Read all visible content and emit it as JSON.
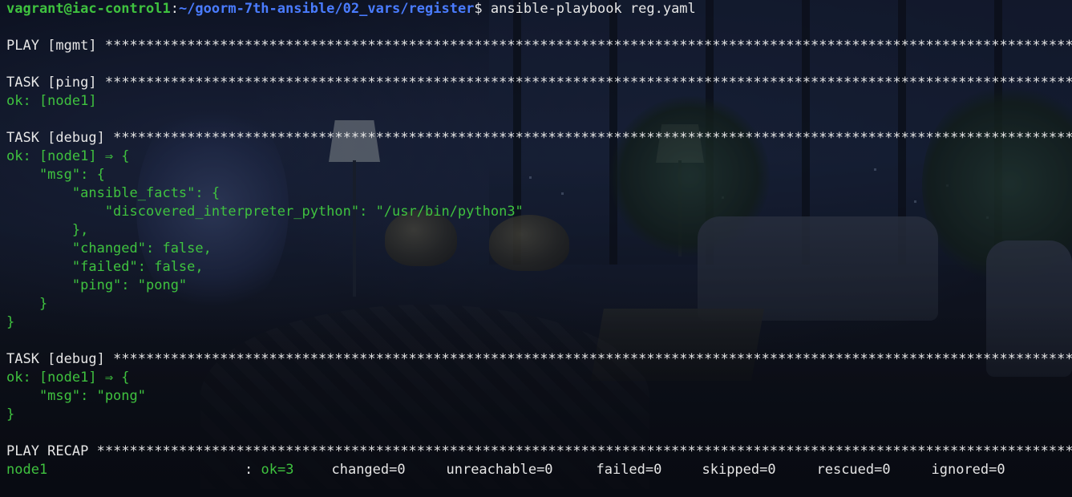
{
  "prompt": {
    "user_host": "vagrant@iac-control1",
    "separator": ":",
    "path": "~/goorm-7th-ansible/02_vars/register",
    "symbol": "$",
    "command": " ansible-playbook reg.yaml"
  },
  "output": {
    "play_header": "PLAY [mgmt]",
    "task1_header": "TASK [ping]",
    "task1_result": "ok: [node1]",
    "task2_header": "TASK [debug]",
    "task2_lines": [
      "ok: [node1] ⇒ {",
      "    \"msg\": {",
      "        \"ansible_facts\": {",
      "            \"discovered_interpreter_python\": \"/usr/bin/python3\"",
      "        },",
      "        \"changed\": false,",
      "        \"failed\": false,",
      "        \"ping\": \"pong\"",
      "    }",
      "}"
    ],
    "task3_header": "TASK [debug]",
    "task3_lines": [
      "ok: [node1] ⇒ {",
      "    \"msg\": \"pong\"",
      "}"
    ],
    "recap_header": "PLAY RECAP",
    "recap": {
      "host": "node1",
      "colon": ": ",
      "ok": "ok=3",
      "changed": "changed=0",
      "unreachable": "unreachable=0",
      "failed": "failed=0",
      "skipped": "skipped=0",
      "rescued": "rescued=0",
      "ignored": "ignored=0"
    },
    "stars": "**************************************************************************************************************************"
  },
  "colors": {
    "green": "#3fc23f",
    "path_blue": "#4a7cff",
    "text": "#e6e6e6"
  }
}
